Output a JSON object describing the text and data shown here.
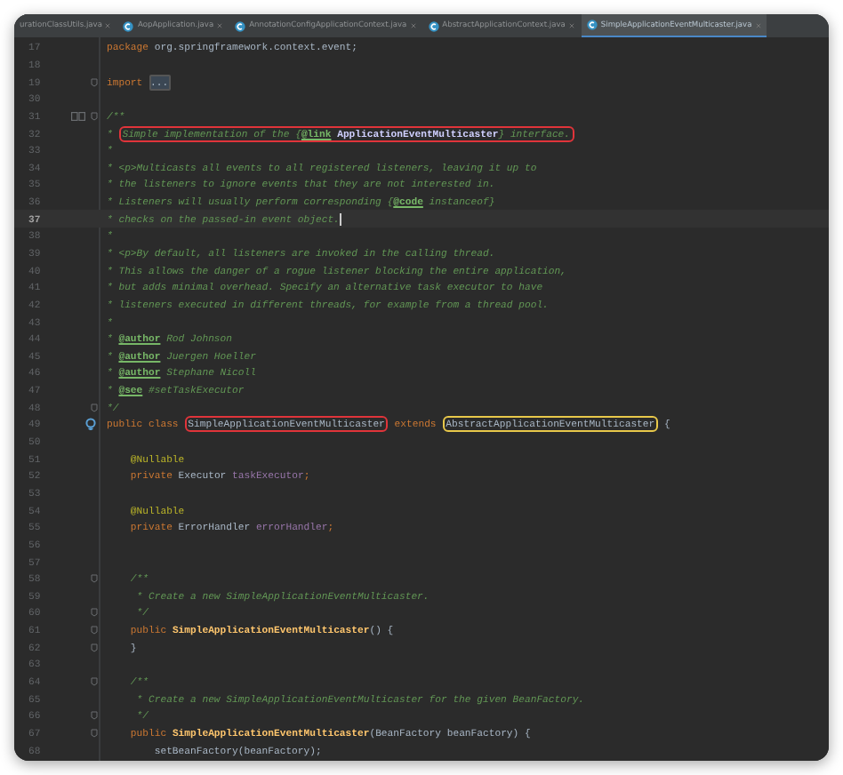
{
  "tabs": [
    {
      "label": "urationClassUtils.java",
      "selected": false,
      "icon": false
    },
    {
      "label": "AopApplication.java",
      "selected": false,
      "icon": true
    },
    {
      "label": "AnnotationConfigApplicationContext.java",
      "selected": false,
      "icon": true
    },
    {
      "label": "AbstractApplicationContext.java",
      "selected": false,
      "icon": true
    },
    {
      "label": "SimpleApplicationEventMulticaster.java",
      "selected": true,
      "icon": true
    }
  ],
  "lines": [
    {
      "number": "17",
      "tokens": [
        {
          "kind": "keyword",
          "text": "package"
        },
        {
          "kind": "plain",
          "text": " org.springframework.context.event;"
        }
      ]
    },
    {
      "number": "18"
    },
    {
      "number": "19",
      "fold": true,
      "tokens": [
        {
          "kind": "keyword",
          "text": "import"
        },
        {
          "kind": "folded",
          "text": "..."
        }
      ]
    },
    {
      "number": "30"
    },
    {
      "number": "31",
      "doc_toggle": true,
      "fold": true,
      "tokens": [
        {
          "kind": "doc",
          "text": "/**"
        }
      ]
    },
    {
      "number": "32",
      "tokens": [
        {
          "kind": "doc",
          "text": "* "
        },
        {
          "kind": "outline",
          "color": "#e0343a",
          "tokens": [
            {
              "kind": "doc",
              "text": "Simple implementation of the "
            },
            {
              "kind": "doc",
              "text": "{"
            },
            {
              "kind": "doctag",
              "text": "@link"
            },
            {
              "kind": "docref",
              "text": " ApplicationEventMulticaster"
            },
            {
              "kind": "doc",
              "text": "} interface."
            }
          ]
        }
      ]
    },
    {
      "number": "33",
      "tokens": [
        {
          "kind": "doc",
          "text": "*"
        }
      ]
    },
    {
      "number": "34",
      "tokens": [
        {
          "kind": "doc",
          "text": "* <p>Multicasts all events to all registered listeners, leaving it up to"
        }
      ]
    },
    {
      "number": "35",
      "tokens": [
        {
          "kind": "doc",
          "text": "* the listeners to ignore events that they are not interested in."
        }
      ]
    },
    {
      "number": "36",
      "tokens": [
        {
          "kind": "doc",
          "text": "* Listeners will usually perform corresponding {"
        },
        {
          "kind": "doctag",
          "text": "@code"
        },
        {
          "kind": "doc",
          "text": " instanceof}"
        }
      ]
    },
    {
      "number": "37",
      "current": true,
      "caret": true,
      "tokens": [
        {
          "kind": "doc",
          "text": "* checks on the passed-in event object."
        }
      ]
    },
    {
      "number": "38",
      "tokens": [
        {
          "kind": "doc",
          "text": "*"
        }
      ]
    },
    {
      "number": "39",
      "tokens": [
        {
          "kind": "doc",
          "text": "* <p>By default, all listeners are invoked in the calling thread."
        }
      ]
    },
    {
      "number": "40",
      "tokens": [
        {
          "kind": "doc",
          "text": "* This allows the danger of a rogue listener blocking the entire application,"
        }
      ]
    },
    {
      "number": "41",
      "tokens": [
        {
          "kind": "doc",
          "text": "* but adds minimal overhead. Specify an alternative task executor to have"
        }
      ]
    },
    {
      "number": "42",
      "tokens": [
        {
          "kind": "doc",
          "text": "* listeners executed in different threads, for example from a thread pool."
        }
      ]
    },
    {
      "number": "43",
      "tokens": [
        {
          "kind": "doc",
          "text": "*"
        }
      ]
    },
    {
      "number": "44",
      "tokens": [
        {
          "kind": "doc",
          "text": "* "
        },
        {
          "kind": "doctag",
          "text": "@author"
        },
        {
          "kind": "doc",
          "text": " Rod Johnson"
        }
      ]
    },
    {
      "number": "45",
      "tokens": [
        {
          "kind": "doc",
          "text": "* "
        },
        {
          "kind": "doctag",
          "text": "@author"
        },
        {
          "kind": "doc",
          "text": " Juergen Hoeller"
        }
      ]
    },
    {
      "number": "46",
      "tokens": [
        {
          "kind": "doc",
          "text": "* "
        },
        {
          "kind": "doctag",
          "text": "@author"
        },
        {
          "kind": "doc",
          "text": " Stephane Nicoll"
        }
      ]
    },
    {
      "number": "47",
      "tokens": [
        {
          "kind": "doc",
          "text": "* "
        },
        {
          "kind": "doctag",
          "text": "@see"
        },
        {
          "kind": "doc",
          "text": " #setTaskExecutor"
        }
      ]
    },
    {
      "number": "48",
      "fold": true,
      "tokens": [
        {
          "kind": "doc",
          "text": "*/"
        }
      ]
    },
    {
      "number": "49",
      "implemented": true,
      "tokens": [
        {
          "kind": "keyword",
          "text": "public class "
        },
        {
          "kind": "outline",
          "color": "#e0343a",
          "tokens": [
            {
              "kind": "plain",
              "text": "SimpleApplicationEventMulticaster"
            }
          ]
        },
        {
          "kind": "keyword",
          "text": " extends "
        },
        {
          "kind": "outline",
          "color": "#e8c84a",
          "tokens": [
            {
              "kind": "plain",
              "text": "AbstractApplicationEventMulticaster"
            }
          ]
        },
        {
          "kind": "plain",
          "text": " {"
        }
      ]
    },
    {
      "number": "50"
    },
    {
      "number": "51",
      "tokens": [
        {
          "kind": "annotation",
          "text": "    @Nullable"
        }
      ]
    },
    {
      "number": "52",
      "tokens": [
        {
          "kind": "keyword",
          "text": "    private "
        },
        {
          "kind": "plain",
          "text": "Executor "
        },
        {
          "kind": "field",
          "text": "taskExecutor"
        },
        {
          "kind": "keyword",
          "text": ";"
        }
      ]
    },
    {
      "number": "53"
    },
    {
      "number": "54",
      "tokens": [
        {
          "kind": "annotation",
          "text": "    @Nullable"
        }
      ]
    },
    {
      "number": "55",
      "tokens": [
        {
          "kind": "keyword",
          "text": "    private "
        },
        {
          "kind": "plain",
          "text": "ErrorHandler "
        },
        {
          "kind": "field",
          "text": "errorHandler"
        },
        {
          "kind": "keyword",
          "text": ";"
        }
      ]
    },
    {
      "number": "56"
    },
    {
      "number": "57"
    },
    {
      "number": "58",
      "fold": true,
      "tokens": [
        {
          "kind": "doc",
          "text": "    /**"
        }
      ]
    },
    {
      "number": "59",
      "tokens": [
        {
          "kind": "doc",
          "text": "     * Create a new SimpleApplicationEventMulticaster."
        }
      ]
    },
    {
      "number": "60",
      "fold": true,
      "tokens": [
        {
          "kind": "doc",
          "text": "     */"
        }
      ]
    },
    {
      "number": "61",
      "fold": true,
      "tokens": [
        {
          "kind": "keyword",
          "text": "    public "
        },
        {
          "kind": "method",
          "text": "SimpleApplicationEventMulticaster"
        },
        {
          "kind": "plain",
          "text": "() {"
        }
      ]
    },
    {
      "number": "62",
      "fold": true,
      "tokens": [
        {
          "kind": "plain",
          "text": "    }"
        }
      ]
    },
    {
      "number": "63"
    },
    {
      "number": "64",
      "fold": true,
      "tokens": [
        {
          "kind": "doc",
          "text": "    /**"
        }
      ]
    },
    {
      "number": "65",
      "tokens": [
        {
          "kind": "doc",
          "text": "     * Create a new SimpleApplicationEventMulticaster for the given BeanFactory."
        }
      ]
    },
    {
      "number": "66",
      "fold": true,
      "tokens": [
        {
          "kind": "doc",
          "text": "     */"
        }
      ]
    },
    {
      "number": "67",
      "fold": true,
      "tokens": [
        {
          "kind": "keyword",
          "text": "    public "
        },
        {
          "kind": "method",
          "text": "SimpleApplicationEventMulticaster"
        },
        {
          "kind": "plain",
          "text": "(BeanFactory beanFactory) {"
        }
      ]
    },
    {
      "number": "68",
      "tokens": [
        {
          "kind": "plain",
          "text": "        setBeanFactory(beanFactory);"
        }
      ]
    }
  ]
}
